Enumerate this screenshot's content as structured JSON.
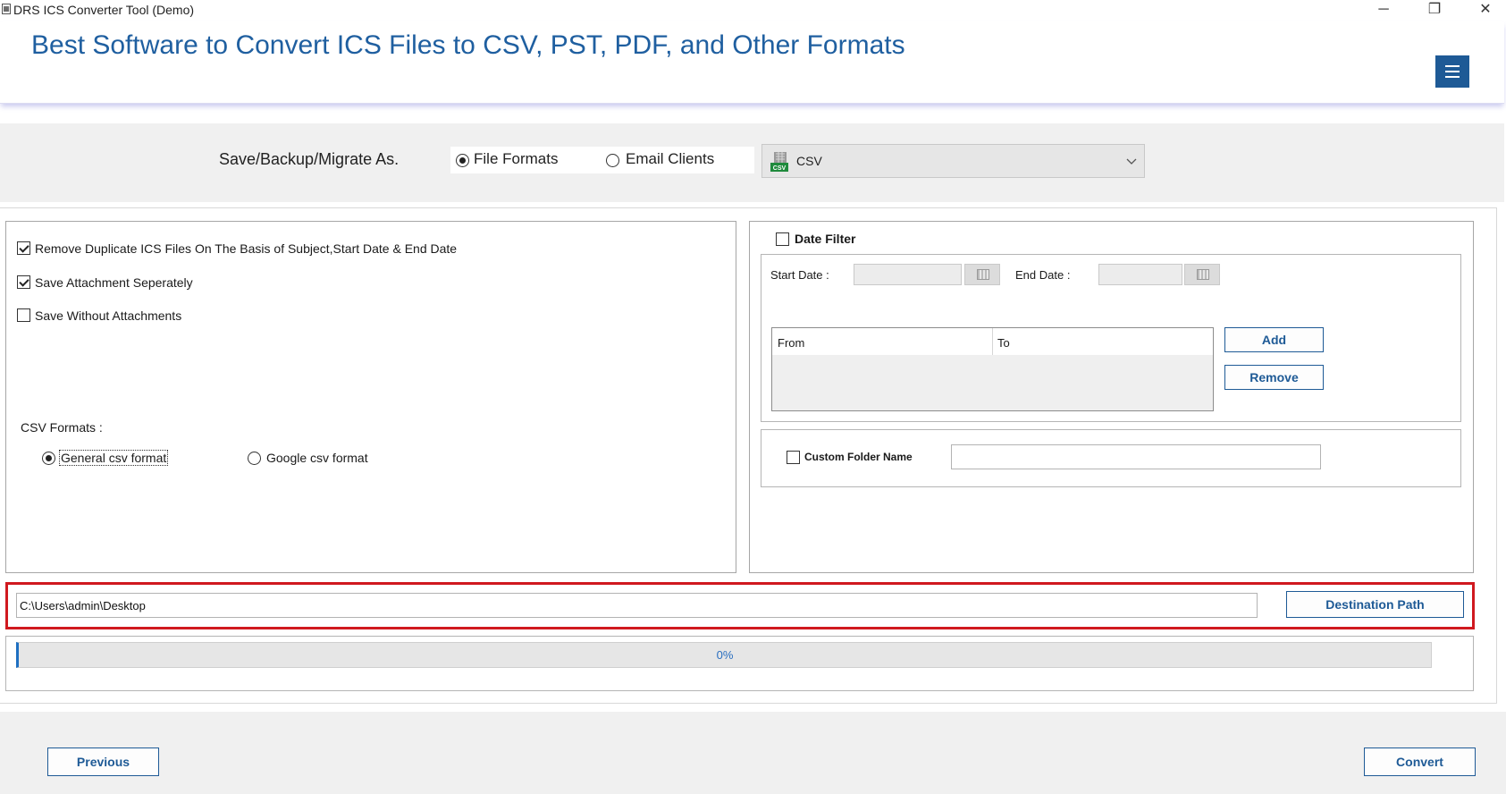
{
  "window": {
    "title": "DRS ICS Converter Tool (Demo)",
    "minimize_glyph": "─",
    "restore_glyph": "❐",
    "close_glyph": "✕"
  },
  "header": {
    "title": "Best Software to Convert ICS Files to CSV, PST, PDF, and Other Formats",
    "menu_icon": "hamburger-menu-icon"
  },
  "save_as": {
    "label": "Save/Backup/Migrate As.",
    "options": [
      {
        "label": "File Formats",
        "selected": true
      },
      {
        "label": "Email Clients",
        "selected": false
      }
    ],
    "format_selected": "CSV",
    "format_icon_text": "CSV"
  },
  "options_panel": {
    "checkboxes": [
      {
        "label": "Remove Duplicate ICS Files On The Basis of Subject,Start Date & End Date",
        "checked": true
      },
      {
        "label": "Save Attachment Seperately",
        "checked": true
      },
      {
        "label": "Save Without Attachments",
        "checked": false
      }
    ],
    "csv_formats_label": "CSV Formats :",
    "csv_formats": [
      {
        "label": "General csv format",
        "selected": true
      },
      {
        "label": "Google csv format",
        "selected": false
      }
    ]
  },
  "date_filter": {
    "label": "Date Filter",
    "checked": false,
    "start_label": "Start Date :",
    "end_label": "End Date :",
    "start_value": "",
    "end_value": "",
    "table_headers": [
      "From",
      "To"
    ],
    "add_label": "Add",
    "remove_label": "Remove"
  },
  "custom_folder": {
    "label": "Custom Folder Name",
    "checked": false,
    "value": ""
  },
  "destination": {
    "path": "C:\\Users\\admin\\Desktop",
    "button_label": "Destination Path"
  },
  "progress": {
    "value": 0,
    "text": "0%"
  },
  "footer": {
    "previous_label": "Previous",
    "convert_label": "Convert"
  },
  "colors": {
    "accent": "#1e5a96",
    "title_text": "#1f5fa0",
    "highlight_border": "#d0191f",
    "panel_background": "#f0f0f0"
  }
}
